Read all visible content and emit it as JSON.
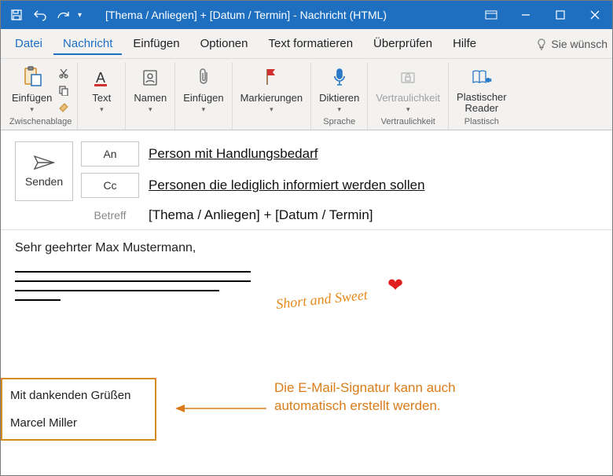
{
  "titlebar": {
    "title": "[Thema / Anliegen] + [Datum / Termin]  -  Nachricht (HTML)"
  },
  "menu": {
    "datei": "Datei",
    "nachricht": "Nachricht",
    "einfuegen": "Einfügen",
    "optionen": "Optionen",
    "text_format": "Text formatieren",
    "ueberpruefen": "Überprüfen",
    "hilfe": "Hilfe",
    "tell_me": "Sie wünsch"
  },
  "ribbon": {
    "clipboard": {
      "einfuegen": "Einfügen",
      "group": "Zwischenablage"
    },
    "text": "Text",
    "namen": "Namen",
    "einfuegen2": "Einfügen",
    "markierungen": "Markierungen",
    "sprache": {
      "diktieren": "Diktieren",
      "group": "Sprache"
    },
    "vertraulichkeit": {
      "label": "Vertraulichkeit",
      "group": "Vertraulichkeit"
    },
    "plastisch": {
      "reader1": "Plastischer",
      "reader2": "Reader",
      "group": "Plastisch"
    }
  },
  "compose": {
    "send": "Senden",
    "an": "An",
    "an_value": "Person mit Handlungsbedarf",
    "cc": "Cc",
    "cc_value": "Personen die lediglich informiert werden sollen",
    "betreff": "Betreff",
    "betreff_value": "[Thema / Anliegen] + [Datum / Termin]"
  },
  "body": {
    "greeting": "Sehr geehrter Max Mustermann,",
    "annotation_sweet": "Short and Sweet",
    "signature_line1": "Mit dankenden Grüßen",
    "signature_line2": "Marcel Miller",
    "annotation_sig": "Die E-Mail-Signatur kann auch automatisch erstellt werden."
  }
}
